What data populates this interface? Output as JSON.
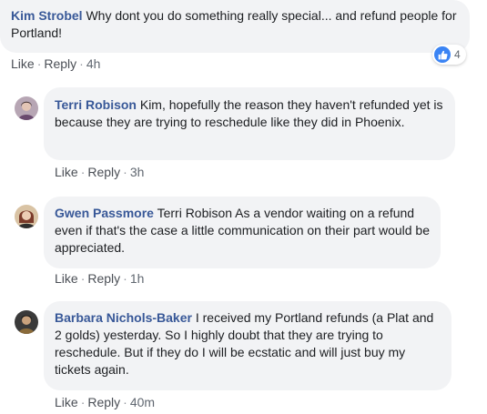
{
  "comments": [
    {
      "author": "Kim Strobel",
      "text": "Why dont you do something really special... and refund people for Portland!",
      "actions": {
        "like": "Like",
        "reply": "Reply",
        "time": "4h"
      },
      "reactions": {
        "count": "4",
        "icon": "thumbs-up-icon",
        "color": "#3b84f4"
      }
    },
    {
      "author": "Terri Robison",
      "text": "Kim, hopefully the reason they haven't refunded yet is because they are trying to reschedule like they did in Phoenix.",
      "actions": {
        "like": "Like",
        "reply": "Reply",
        "time": "3h"
      }
    },
    {
      "author": "Gwen Passmore",
      "text": "Terri Robison As a vendor waiting on a refund even if that's the case a little communication on their part would be appreciated.",
      "actions": {
        "like": "Like",
        "reply": "Reply",
        "time": "1h"
      }
    },
    {
      "author": "Barbara Nichols-Baker",
      "text": "I received my Portland refunds (a Plat and 2 golds) yesterday. So I highly doubt that they are trying to reschedule. But if they do I will be ecstatic and will just buy my tickets again.",
      "actions": {
        "like": "Like",
        "reply": "Reply",
        "time": "40m"
      }
    }
  ],
  "separator": "·"
}
